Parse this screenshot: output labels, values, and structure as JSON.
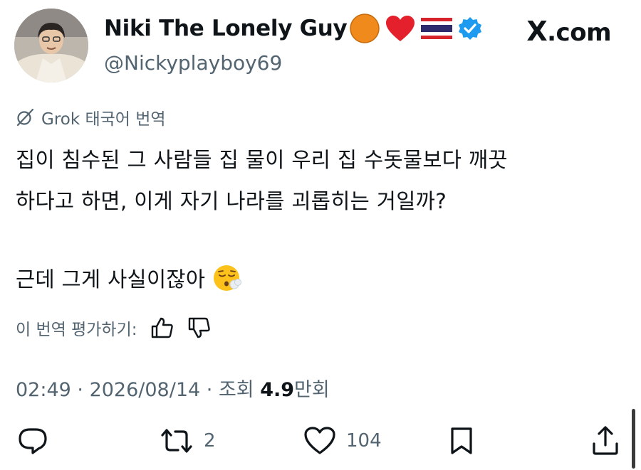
{
  "author": {
    "display_name": "Niki The Lonely Guy",
    "handle": "@Nickyplayboy69",
    "avatar_icon": "profile-photo",
    "badges": [
      "orange-circle-icon",
      "red-heart-icon",
      "thailand-flag-icon",
      "verified-badge-icon"
    ]
  },
  "site": {
    "label": ".com",
    "mark": "X"
  },
  "translation": {
    "label": "Grok 태국어 번역",
    "rate_prompt": "이 번역 평가하기:"
  },
  "tweet": {
    "line1": "집이 침수된 그 사람들 집 물이 우리 집 수돗물보다 깨끗",
    "line2": "하다고 하면, 이게 자기 나라를 괴롭히는 거일까?",
    "line3": "근데 그게 사실이잖아",
    "emoji": "face-exhaling-emoji"
  },
  "meta": {
    "time": "02:49",
    "separator": " · ",
    "date": "2026/08/14",
    "views_label": "조회 ",
    "views_number": "4.9",
    "views_unit": "만회"
  },
  "actions": {
    "reply_count": "",
    "retweet_count": "2",
    "like_count": "104"
  },
  "colors": {
    "text": "#0f1419",
    "secondary": "#536471",
    "verified": "#1d9bf0"
  }
}
